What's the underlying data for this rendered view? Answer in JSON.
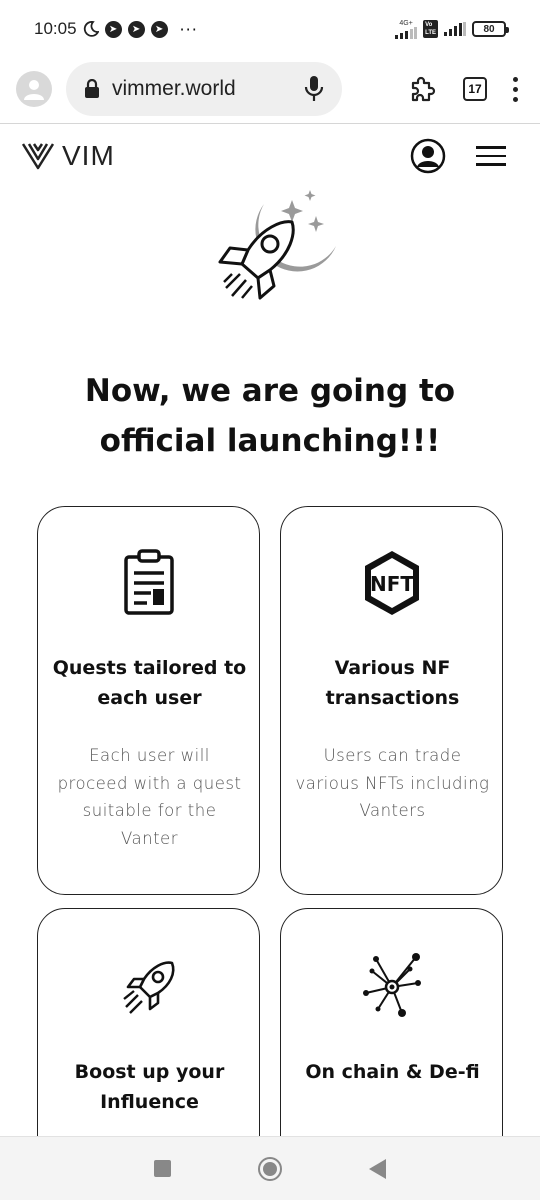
{
  "status_bar": {
    "time": "10:05",
    "more": "···",
    "network_label": "4G+",
    "volte_label": "Vo\nLTE",
    "battery": "80"
  },
  "browser": {
    "url": "vimmer.world",
    "tab_count": "17"
  },
  "site": {
    "logo_text": "VIM"
  },
  "hero": {
    "title": "Now, we are going to official launching!!!"
  },
  "features": [
    {
      "title": "Quests tailored to each user",
      "description": "Each user will proceed with a quest suitable for the Vanter",
      "icon": "clipboard-icon"
    },
    {
      "title": "Various NF transactions",
      "description": "Users can trade various NFTs including Vanters",
      "icon": "nft-icon"
    },
    {
      "title": "Boost up your Influence",
      "description": "",
      "icon": "rocket-icon"
    },
    {
      "title": "On chain & De-fi",
      "description": "",
      "icon": "network-icon"
    }
  ],
  "colors": {
    "text": "#111111",
    "muted_text": "#555555",
    "url_pill": "#efefef",
    "moon": "#9a9a9a"
  }
}
